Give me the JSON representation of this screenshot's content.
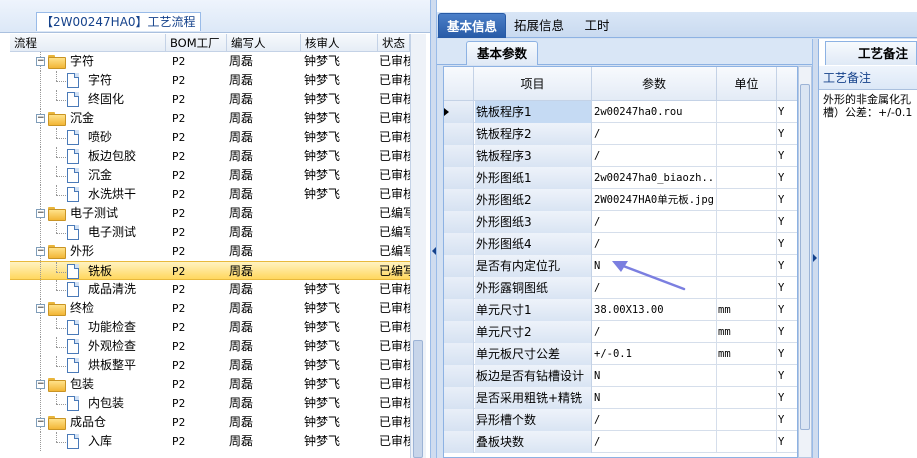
{
  "left_panel": {
    "title": "【2W00247HA0】工艺流程",
    "columns": [
      "流程",
      "BOM工厂",
      "编写人",
      "核审人",
      "状态"
    ],
    "rows": [
      {
        "level": 1,
        "type": "folder",
        "name": "字符",
        "factory": "P2",
        "author": "周磊",
        "reviewer": "钟梦飞",
        "status": "已审核"
      },
      {
        "level": 2,
        "type": "doc",
        "name": "字符",
        "factory": "P2",
        "author": "周磊",
        "reviewer": "钟梦飞",
        "status": "已审核"
      },
      {
        "level": 2,
        "type": "doc",
        "name": "终固化",
        "factory": "P2",
        "author": "周磊",
        "reviewer": "钟梦飞",
        "status": "已审核"
      },
      {
        "level": 1,
        "type": "folder",
        "name": "沉金",
        "factory": "P2",
        "author": "周磊",
        "reviewer": "钟梦飞",
        "status": "已审核"
      },
      {
        "level": 2,
        "type": "doc",
        "name": "喷砂",
        "factory": "P2",
        "author": "周磊",
        "reviewer": "钟梦飞",
        "status": "已审核"
      },
      {
        "level": 2,
        "type": "doc",
        "name": "板边包胶",
        "factory": "P2",
        "author": "周磊",
        "reviewer": "钟梦飞",
        "status": "已审核"
      },
      {
        "level": 2,
        "type": "doc",
        "name": "沉金",
        "factory": "P2",
        "author": "周磊",
        "reviewer": "钟梦飞",
        "status": "已审核"
      },
      {
        "level": 2,
        "type": "doc",
        "name": "水洗烘干",
        "factory": "P2",
        "author": "周磊",
        "reviewer": "钟梦飞",
        "status": "已审核"
      },
      {
        "level": 1,
        "type": "folder",
        "name": "电子测试",
        "factory": "P2",
        "author": "周磊",
        "reviewer": "",
        "status": "已编写"
      },
      {
        "level": 2,
        "type": "doc",
        "name": "电子测试",
        "factory": "P2",
        "author": "周磊",
        "reviewer": "",
        "status": "已编写"
      },
      {
        "level": 1,
        "type": "folder",
        "name": "外形",
        "factory": "P2",
        "author": "周磊",
        "reviewer": "",
        "status": "已编写"
      },
      {
        "level": 2,
        "type": "doc",
        "name": "铣板",
        "factory": "P2",
        "author": "周磊",
        "reviewer": "",
        "status": "已编写",
        "selected": true
      },
      {
        "level": 2,
        "type": "doc",
        "name": "成品清洗",
        "factory": "P2",
        "author": "周磊",
        "reviewer": "钟梦飞",
        "status": "已审核"
      },
      {
        "level": 1,
        "type": "folder",
        "name": "终检",
        "factory": "P2",
        "author": "周磊",
        "reviewer": "钟梦飞",
        "status": "已审核"
      },
      {
        "level": 2,
        "type": "doc",
        "name": "功能检查",
        "factory": "P2",
        "author": "周磊",
        "reviewer": "钟梦飞",
        "status": "已审核"
      },
      {
        "level": 2,
        "type": "doc",
        "name": "外观检查",
        "factory": "P2",
        "author": "周磊",
        "reviewer": "钟梦飞",
        "status": "已审核"
      },
      {
        "level": 2,
        "type": "doc",
        "name": "烘板整平",
        "factory": "P2",
        "author": "周磊",
        "reviewer": "钟梦飞",
        "status": "已审核"
      },
      {
        "level": 1,
        "type": "folder",
        "name": "包装",
        "factory": "P2",
        "author": "周磊",
        "reviewer": "钟梦飞",
        "status": "已审核"
      },
      {
        "level": 2,
        "type": "doc",
        "name": "内包装",
        "factory": "P2",
        "author": "周磊",
        "reviewer": "钟梦飞",
        "status": "已审核"
      },
      {
        "level": 1,
        "type": "folder",
        "name": "成品仓",
        "factory": "P2",
        "author": "周磊",
        "reviewer": "钟梦飞",
        "status": "已审核"
      },
      {
        "level": 2,
        "type": "doc",
        "name": "入库",
        "factory": "P2",
        "author": "周磊",
        "reviewer": "钟梦飞",
        "status": "已审核"
      }
    ]
  },
  "tabs": [
    {
      "label": "基本信息",
      "active": true
    },
    {
      "label": "拓展信息",
      "active": false
    },
    {
      "label": "工时",
      "active": false
    }
  ],
  "sub_tab": {
    "label": "基本参数"
  },
  "param_grid": {
    "columns": {
      "item": "项目",
      "param": "参数",
      "unit": "单位"
    },
    "rows": [
      {
        "name": "铣板程序1",
        "value": "2w00247ha0.rou",
        "unit": "",
        "flag": "Y",
        "current": true
      },
      {
        "name": "铣板程序2",
        "value": "/",
        "unit": "",
        "flag": "Y"
      },
      {
        "name": "铣板程序3",
        "value": "/",
        "unit": "",
        "flag": "Y"
      },
      {
        "name": "外形图纸1",
        "value": "2w00247ha0_biaozh...",
        "unit": "",
        "flag": "Y"
      },
      {
        "name": "外形图纸2",
        "value": "2W00247HA0单元板.jpg",
        "unit": "",
        "flag": "Y"
      },
      {
        "name": "外形图纸3",
        "value": "/",
        "unit": "",
        "flag": "Y"
      },
      {
        "name": "外形图纸4",
        "value": "/",
        "unit": "",
        "flag": "Y"
      },
      {
        "name": "是否有内定位孔",
        "value": "N",
        "unit": "",
        "flag": "Y"
      },
      {
        "name": "外形露铜图纸",
        "value": "/",
        "unit": "",
        "flag": "Y"
      },
      {
        "name": "单元尺寸1",
        "value": "38.00X13.00",
        "unit": "mm",
        "flag": "Y"
      },
      {
        "name": "单元尺寸2",
        "value": "/",
        "unit": "mm",
        "flag": "Y"
      },
      {
        "name": "单元板尺寸公差",
        "value": "+/-0.1",
        "unit": "mm",
        "flag": "Y"
      },
      {
        "name": "板边是否有钻槽设计",
        "value": "N",
        "unit": "",
        "flag": "Y"
      },
      {
        "name": "是否采用粗铣+精铣",
        "value": "N",
        "unit": "",
        "flag": "Y"
      },
      {
        "name": "异形槽个数",
        "value": "/",
        "unit": "",
        "flag": "Y"
      },
      {
        "name": "叠板块数",
        "value": "/",
        "unit": "",
        "flag": "Y"
      }
    ]
  },
  "notes_panel": {
    "header": "工艺备注",
    "subheader": "工艺备注",
    "text": "外形的非金属化孔\n槽）公差：+/-0.1"
  },
  "colors": {
    "selection": "#ffd75e",
    "active_tab": "#275aa6",
    "annotation_arrow": "#7b7fe0"
  }
}
